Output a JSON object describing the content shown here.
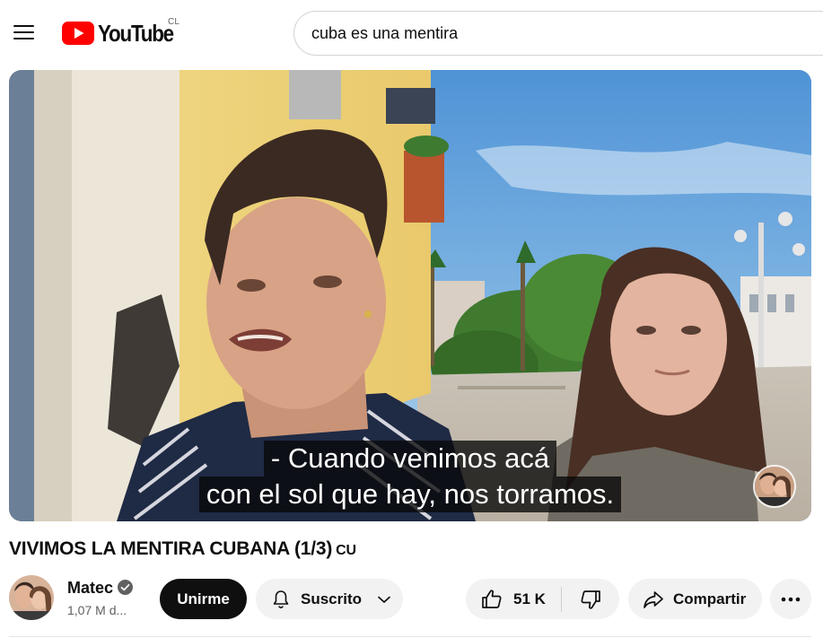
{
  "header": {
    "logo_text": "YouTube",
    "country_code": "CL",
    "search_value": "cuba es una mentira",
    "icons": {
      "menu": "menu-icon",
      "logo": "youtube-play-icon"
    }
  },
  "player": {
    "subtitle_lines": [
      "- Cuando venimos acá",
      "con el sol que hay, nos torramos."
    ]
  },
  "video": {
    "title": "VIVIMOS LA MENTIRA CUBANA (1/3)",
    "title_tag": "CU"
  },
  "channel": {
    "name": "Matec",
    "subscribers": "1,07 M d...",
    "verified": true,
    "join_label": "Unirme",
    "subscribed_label": "Suscrito"
  },
  "actions": {
    "like_count": "51 K",
    "share_label": "Compartir",
    "icons": {
      "bell": "bell-icon",
      "chevron": "chevron-down-icon",
      "like": "thumbs-up-icon",
      "dislike": "thumbs-down-icon",
      "share": "share-arrow-icon",
      "more": "more-horizontal-icon"
    }
  },
  "colors": {
    "brand_red": "#ff0000",
    "join_bg": "#0f0f0f",
    "button_bg": "#f2f2f2",
    "text": "#0f0f0f",
    "secondary_text": "#606060"
  }
}
